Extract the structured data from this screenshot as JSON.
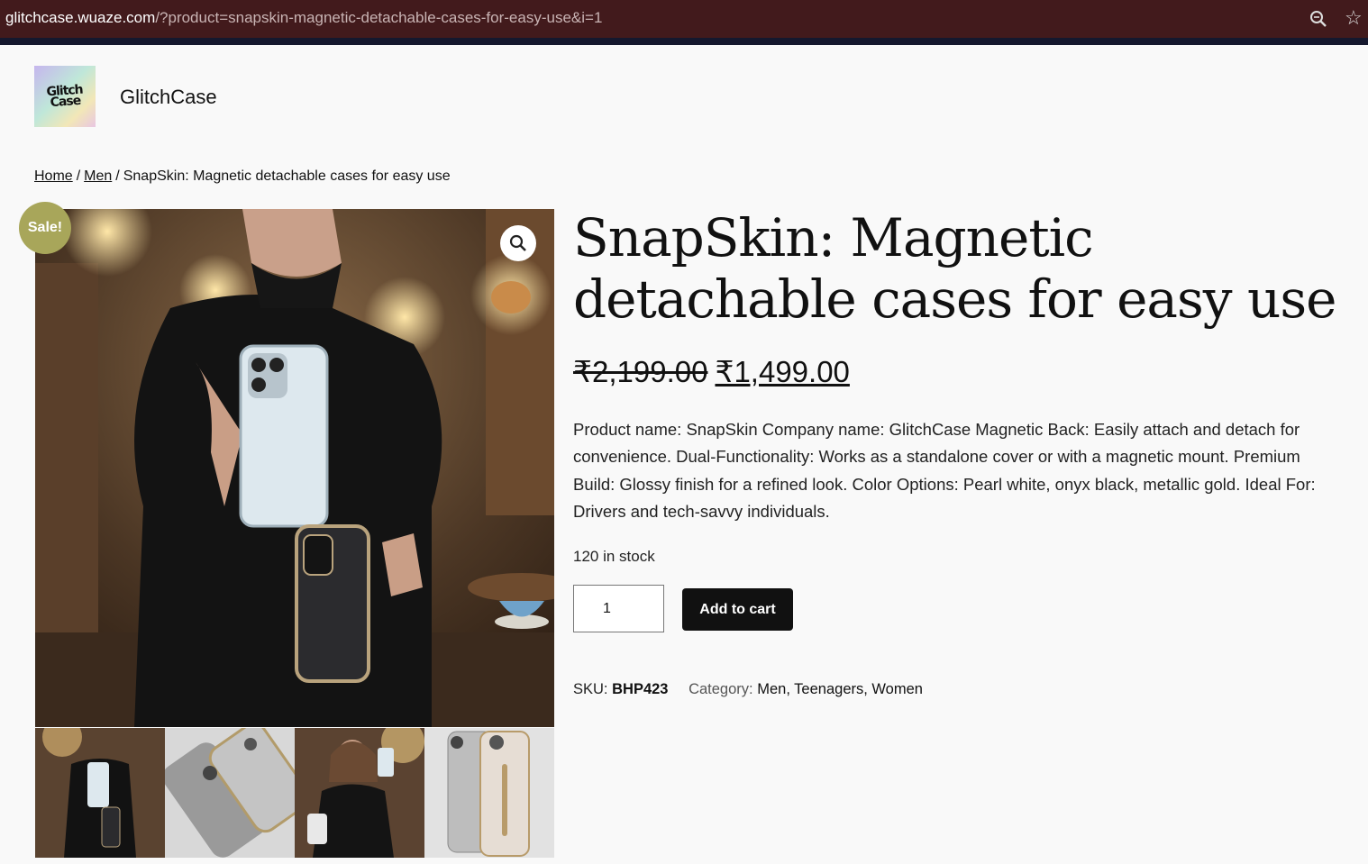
{
  "browser": {
    "url_host": "glitchcase.wuaze.com",
    "url_rest": "/?product=snapskin-magnetic-detachable-cases-for-easy-use&i=1"
  },
  "site": {
    "logo_text": "Glitch Case",
    "title": "GlitchCase"
  },
  "breadcrumb": {
    "home": "Home",
    "sep1": "/",
    "men": "Men",
    "sep2": "/",
    "current": "SnapSkin: Magnetic detachable cases for easy use"
  },
  "gallery": {
    "sale_badge": "Sale!",
    "thumbnail_count": 4
  },
  "product": {
    "title": "SnapSkin: Magnetic detachable cases for easy use",
    "old_price": "₹2,199.00",
    "new_price": "₹1,499.00",
    "description": "Product name: SnapSkin Company name: GlitchCase Magnetic Back: Easily attach and detach for convenience. Dual-Functionality: Works as a standalone cover or with a magnetic mount. Premium Build: Glossy finish for a refined look. Color Options: Pearl white, onyx black, metallic gold. Ideal For: Drivers and tech-savvy individuals.",
    "stock": "120 in stock",
    "quantity": "1",
    "add_to_cart": "Add to cart",
    "sku_label": "SKU:",
    "sku": "BHP423",
    "category_label": "Category:",
    "categories": "Men, Teenagers, Women"
  },
  "colors": {
    "url_bar": "#421a1c",
    "sale_badge": "#a8a65a",
    "button": "#111111"
  }
}
